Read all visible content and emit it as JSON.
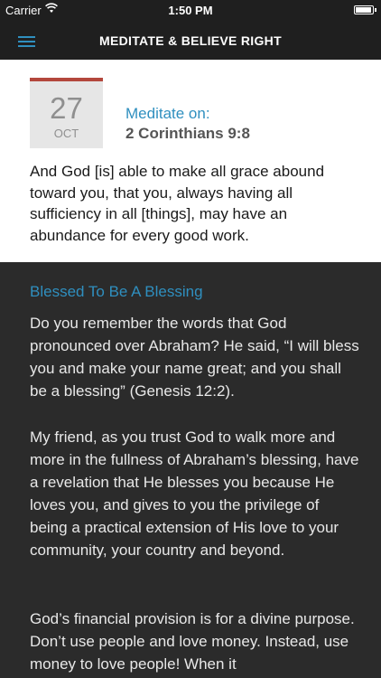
{
  "status_bar": {
    "carrier": "Carrier",
    "time": "1:50 PM",
    "battery_level": 0.95
  },
  "nav": {
    "title": "MEDITATE & BELIEVE RIGHT",
    "menu_icon": "hamburger-menu-icon",
    "accent_color": "#2f8fbf"
  },
  "date": {
    "day": "27",
    "month": "OCT",
    "accent_color": "#b3473c"
  },
  "meditate": {
    "label": "Meditate on:",
    "reference": "2 Corinthians 9:8",
    "verse": "And God [is] able to make all grace abound toward you, that you, always having all sufficiency in all [things], may have an abundance for every good work."
  },
  "devotion": {
    "title": "Blessed To Be A Blessing",
    "paragraphs": [
      "Do you remember the words that God pronounced over Abraham? He said, “I will bless you and make your name great; and you shall be a blessing” (Genesis 12:2).",
      "My friend, as you trust God to walk more and more in the fullness of Abraham’s blessing, have a revelation that He blesses you because He loves you, and gives to you the privilege of being a practical extension of His love to your community, your country and beyond.",
      "God’s financial provision is for a divine purpose. Don’t use people and love money. Instead, use money to love people! When it"
    ]
  }
}
